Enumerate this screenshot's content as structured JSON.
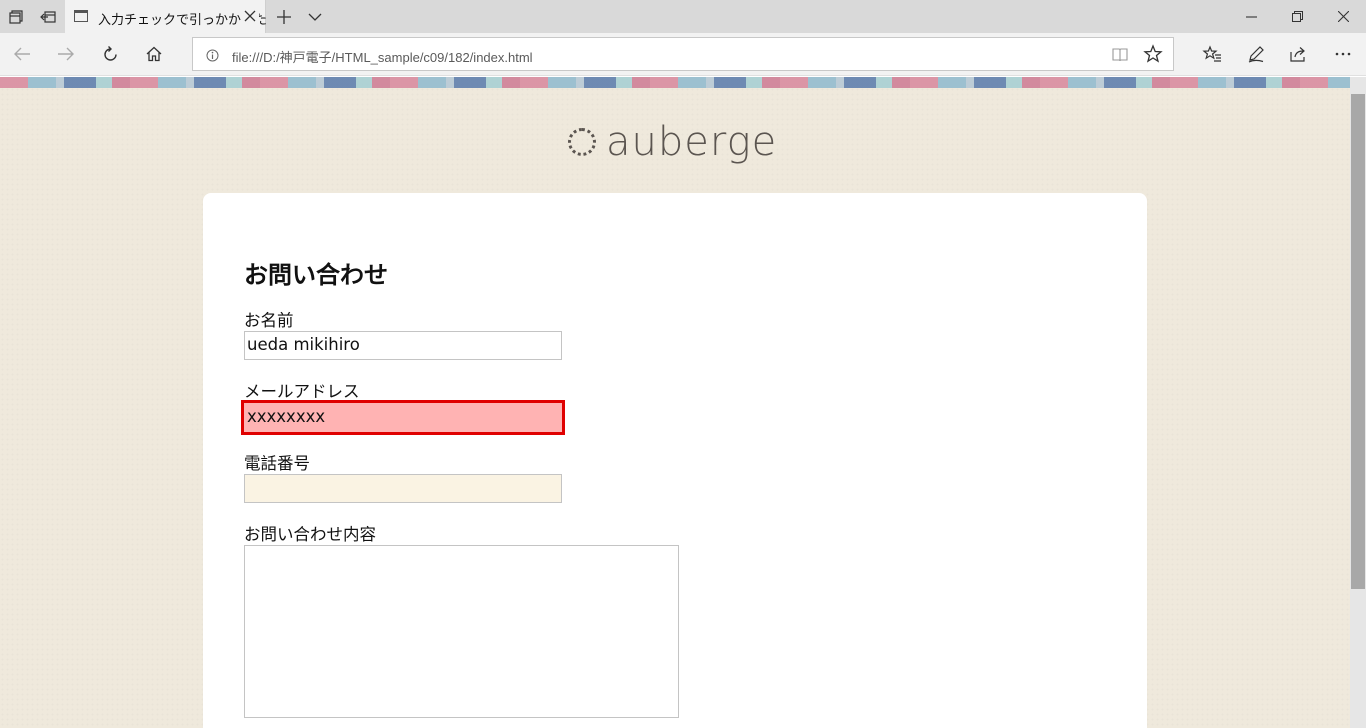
{
  "browser": {
    "tab": {
      "title": "入力チェックで引っかかった"
    },
    "address": {
      "url": "file:///D:/神戸電子/HTML_sample/c09/182/index.html"
    },
    "icons": [
      "tab-manager-icon",
      "tab-aside-icon",
      "page-icon",
      "close-icon",
      "new-tab-plus-icon",
      "chevron-down-icon",
      "minimize-icon",
      "restore-icon",
      "close-window-icon",
      "back-arrow-icon",
      "forward-arrow-icon",
      "refresh-icon",
      "home-icon",
      "info-icon",
      "reading-view-icon",
      "favorite-star-icon",
      "favorites-hub-icon",
      "pen-icon",
      "share-icon",
      "more-icon"
    ]
  },
  "site": {
    "logo_text": "auberge"
  },
  "form": {
    "title": "お問い合わせ",
    "fields": [
      {
        "label": "お名前",
        "value": "ueda mikihiro"
      },
      {
        "label": "メールアドレス",
        "value": "xxxxxxxx",
        "state": "error"
      },
      {
        "label": "電話番号",
        "value": ""
      },
      {
        "label": "お問い合わせ内容",
        "value": ""
      }
    ]
  },
  "colors": {
    "error_border": "#e00000",
    "error_fill": "#ffb3b3",
    "page_background": "#efe9dc",
    "logo": "#5b5550"
  }
}
